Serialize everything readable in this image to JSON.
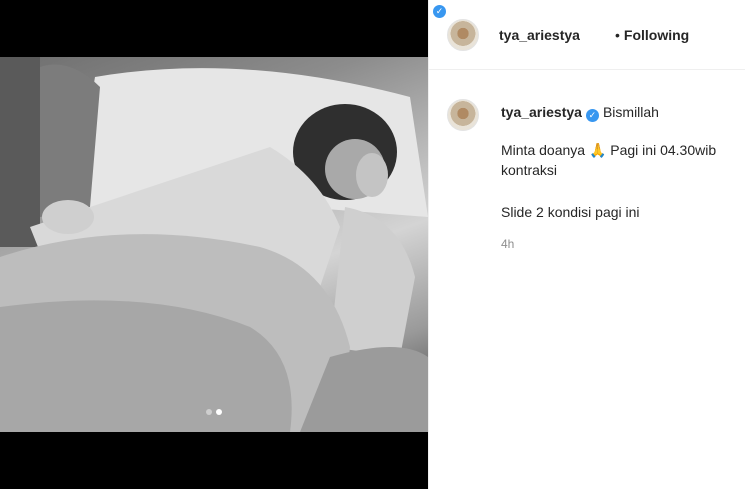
{
  "post": {
    "username": "tya_ariestya",
    "follow_label": "Following",
    "separator": "•"
  },
  "caption": {
    "username": "tya_ariestya",
    "title": "Bismillah",
    "line1": "Minta doanya 🙏 Pagi ini 04.30wib kontraksi",
    "line2": "Slide 2 kondisi pagi ini",
    "time": "4h"
  },
  "carousel": {
    "slides": 2,
    "active_slide": 2
  },
  "colors": {
    "verified": "#3897f0",
    "media_bg": "#000000",
    "muted": "#8e8e8e"
  }
}
